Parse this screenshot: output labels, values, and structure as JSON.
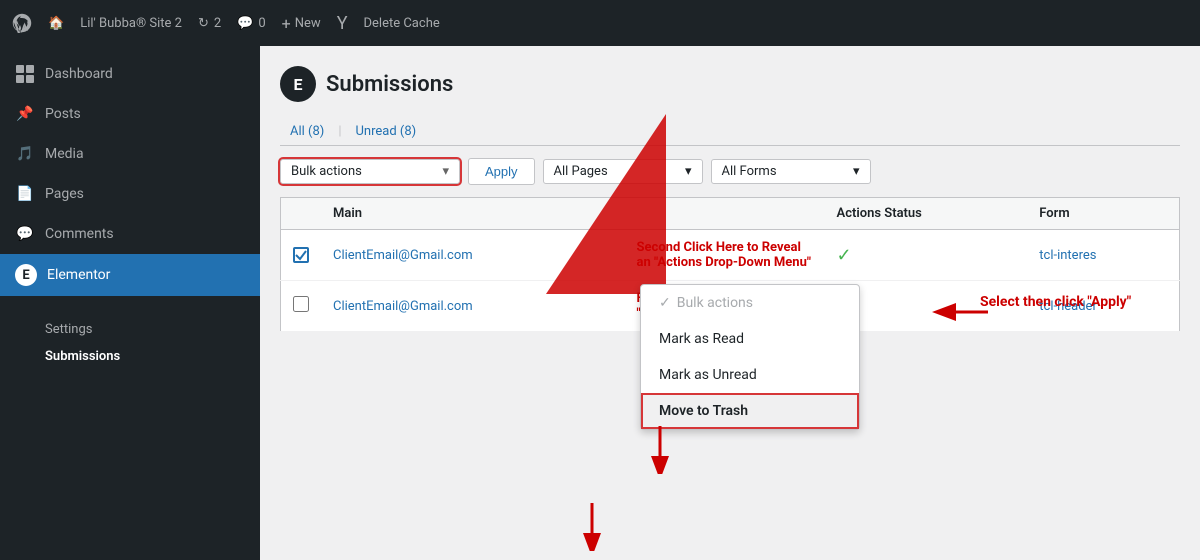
{
  "adminBar": {
    "siteName": "Lil' Bubba® Site 2",
    "updates": "2",
    "comments": "0",
    "newLabel": "New",
    "deleteCache": "Delete Cache"
  },
  "sidebar": {
    "items": [
      {
        "id": "dashboard",
        "label": "Dashboard",
        "icon": "dashboard"
      },
      {
        "id": "posts",
        "label": "Posts",
        "icon": "posts"
      },
      {
        "id": "media",
        "label": "Media",
        "icon": "media"
      },
      {
        "id": "pages",
        "label": "Pages",
        "icon": "pages"
      },
      {
        "id": "comments",
        "label": "Comments",
        "icon": "comments"
      },
      {
        "id": "elementor",
        "label": "Elementor",
        "icon": "elementor",
        "active": true
      }
    ],
    "bottomItems": [
      {
        "id": "settings",
        "label": "Settings"
      },
      {
        "id": "submissions",
        "label": "Submissions",
        "active": true
      }
    ]
  },
  "page": {
    "title": "Submissions",
    "iconLetter": "E"
  },
  "tabs": [
    {
      "label": "All (8)"
    },
    {
      "label": "Unread (8)"
    }
  ],
  "filterBar": {
    "bulkActionsLabel": "Bulk actions",
    "applyLabel": "Apply",
    "allPagesLabel": "All Pages",
    "allFormsLabel": "All Forms"
  },
  "tableHeaders": [
    "",
    "Main",
    "",
    "Actions Status",
    "Form"
  ],
  "rows": [
    {
      "id": 1,
      "email": "ClientEmail@Gmail.com",
      "status": "✓",
      "form": "tcl-interes",
      "checked": true
    },
    {
      "id": 2,
      "email": "ClientEmail@Gmail.com",
      "status": "✓",
      "form": "tcl-header",
      "checked": false
    }
  ],
  "dropdown": {
    "items": [
      {
        "id": "bulk-actions",
        "label": "Bulk actions",
        "disabled": true,
        "checked": true
      },
      {
        "id": "mark-read",
        "label": "Mark as Read"
      },
      {
        "id": "mark-unread",
        "label": "Mark as Unread"
      },
      {
        "id": "move-trash",
        "label": "Move to Trash",
        "highlighted": true
      }
    ]
  },
  "annotations": {
    "selectApply": "Select then click \"Apply\"",
    "secondClick": "Second Click Here to Reveal an \"Actions Drop-Down Menu\"",
    "firstClick": "First Click the box to Add a \"Checkmark\""
  }
}
